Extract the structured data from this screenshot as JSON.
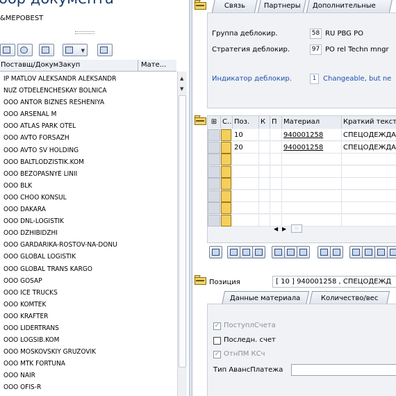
{
  "left": {
    "title": "бор документа",
    "user": "&MEPOBEST",
    "col_vendor": "Поставщ/ДокумЗакуп",
    "col_mat": "Мате...",
    "vendors": [
      "IP MATLOV ALEKSANDR ALEKSANDR",
      "NUZ OTDELENCHESKAY BOLNICA",
      "OOO ANTOR BIZNES RESHENIYA",
      "OOO ARSENAL M",
      "OOO ATLAS PARK OTEL",
      "OOO AVTO FORSAZH",
      "OOO AVTO SV HOLDING",
      "OOO BALTLODZISTIK.KOM",
      "OOO BEZOPASNYE LINII",
      "OOO BLK",
      "OOO CHOO KONSUL",
      "OOO DAKARA",
      "OOO DNL-LOGISTIK",
      "OOO DZHIBIDZHI",
      "OOO GARDARIKA-ROSTOV-NA-DONU",
      "OOO GLOBAL LOGISTIK",
      "OOO GLOBAL TRANS KARGO",
      "OOO GOSAP",
      "OOO ICE TRUCKS",
      "OOO KOMTEK",
      "OOO KRAFTER",
      "OOO LIDERTRANS",
      "OOO LOGSIB.KOM",
      "OOO MOSKOVSKIY GRUZOVIK",
      "OOO MTK FORTUNA",
      "OOO NAIR",
      "OOO OFIS-R"
    ]
  },
  "right": {
    "tabs": [
      "Связь",
      "Партнеры",
      "Дополнительные"
    ],
    "release_group_label": "Группа деблокир.",
    "release_group_code": "58",
    "release_group_text": "RU PBG PO",
    "release_strategy_label": "Стратегия деблокир.",
    "release_strategy_code": "97",
    "release_strategy_text": "PO rel Techn mngr",
    "release_indicator_label": "Индикатор деблокир.",
    "release_indicator_code": "1",
    "release_indicator_text": "Changeable, but ne",
    "table": {
      "headers": [
        "С..",
        "Поз.",
        "К",
        "П",
        "Материал",
        "Краткий текст"
      ],
      "rows": [
        {
          "pos": "10",
          "material": "940001258",
          "text": "СПЕЦОДЕЖДА"
        },
        {
          "pos": "20",
          "material": "940001258",
          "text": "СПЕЦОДЕЖДА"
        }
      ]
    },
    "item_label": "Позиция",
    "item_value": "[ 10 ] 940001258 , СПЕЦОДЕЖД",
    "item_tabs": [
      "Данные материала",
      "Количество/вес"
    ],
    "chk_invoice": "ПоступлСчета",
    "chk_last": "Последн. счет",
    "chk_gr": "ОтнПМ КСч",
    "advance_label": "Тип АвансПлатежа"
  }
}
